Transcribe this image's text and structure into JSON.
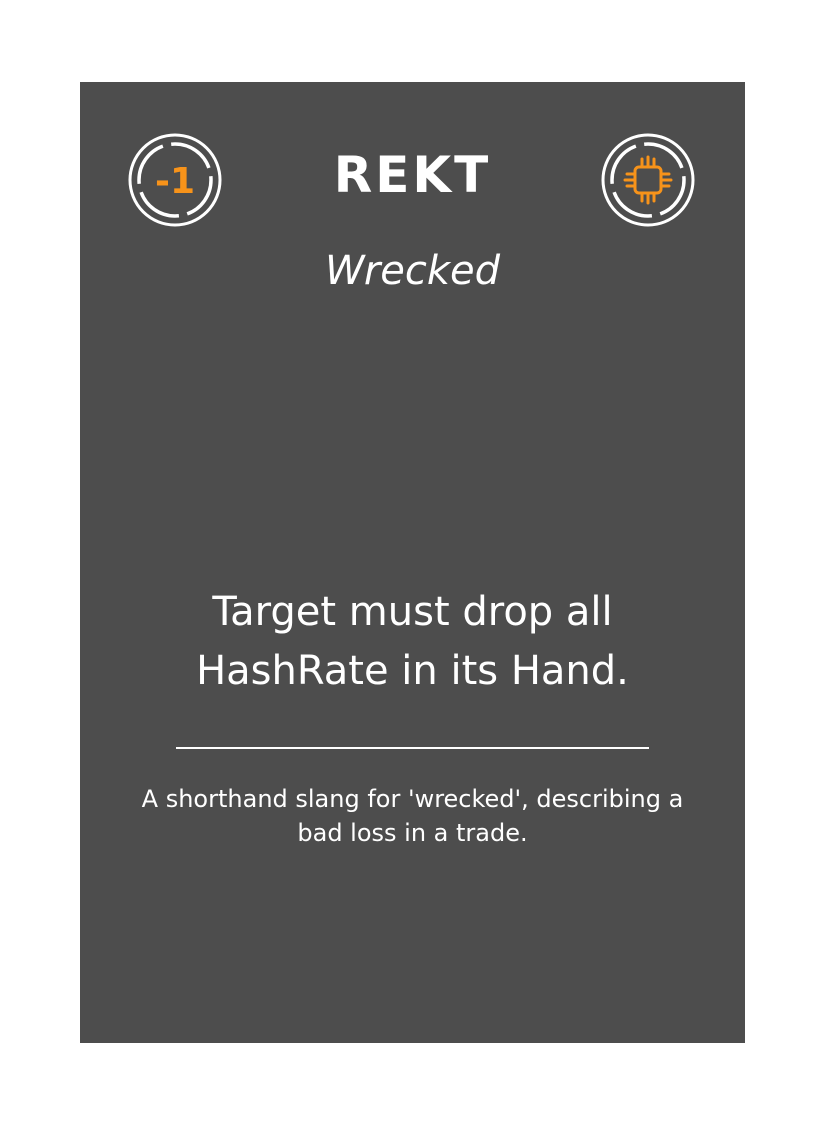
{
  "card": {
    "name": "REKT",
    "subtitle": "Wrecked",
    "cost_badge": "-1",
    "type_icon": "cpu-chip-icon",
    "effect_text": "Target must drop all HashRate in its Hand.",
    "flavor_text": "A shorthand slang for 'wrecked', describing a bad loss in a trade."
  },
  "colors": {
    "card_background": "#4d4d4d",
    "text": "#ffffff",
    "accent": "#f7931a",
    "page_background": "#ffffff"
  }
}
